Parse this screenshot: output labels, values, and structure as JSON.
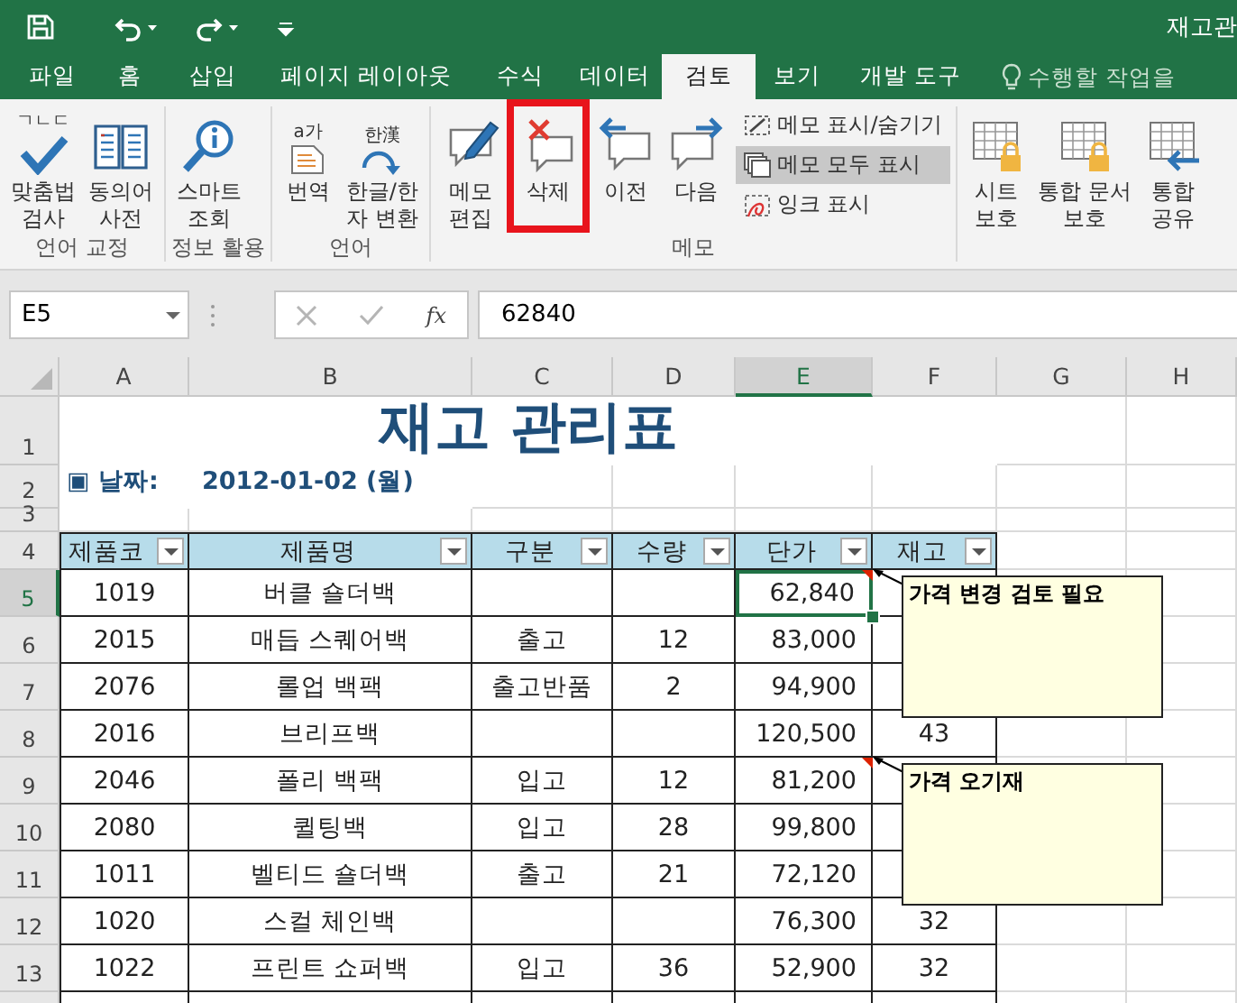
{
  "title_bar": {
    "title": "재고관"
  },
  "tabs": [
    {
      "label": "파일",
      "selected": false
    },
    {
      "label": "홈",
      "selected": false
    },
    {
      "label": "삽입",
      "selected": false
    },
    {
      "label": "페이지 레이아웃",
      "selected": false
    },
    {
      "label": "수식",
      "selected": false
    },
    {
      "label": "데이터",
      "selected": false
    },
    {
      "label": "검토",
      "selected": true
    },
    {
      "label": "보기",
      "selected": false
    },
    {
      "label": "개발 도구",
      "selected": false
    }
  ],
  "tell_me": {
    "placeholder": "수행할 작업을"
  },
  "ribbon": {
    "groups": [
      {
        "label": "언어 교정",
        "buttons": [
          {
            "kind": "large",
            "label": "맞춤법\n검사",
            "icon_text": "ㄱㄴㄷ",
            "highlighted": false
          },
          {
            "kind": "large",
            "label": "동의어\n사전",
            "highlighted": false
          }
        ]
      },
      {
        "label": "정보 활용",
        "buttons": [
          {
            "kind": "large",
            "label": "스마트\n조회",
            "highlighted": false
          }
        ]
      },
      {
        "label": "언어",
        "buttons": [
          {
            "kind": "large",
            "label": "번역",
            "icon_text": "a가",
            "highlighted": false
          },
          {
            "kind": "large",
            "label": "한글/한\n자 변환",
            "icon_text": "한漢",
            "highlighted": false
          }
        ]
      },
      {
        "label": "메모",
        "buttons": [
          {
            "kind": "large",
            "label": "메모\n편집",
            "highlighted": false
          },
          {
            "kind": "large",
            "label": "삭제",
            "highlighted": true
          },
          {
            "kind": "large",
            "label": "이전",
            "highlighted": false
          },
          {
            "kind": "large",
            "label": "다음",
            "highlighted": false
          },
          {
            "kind": "small",
            "label": "메모 표시/숨기기",
            "selected": false
          },
          {
            "kind": "small",
            "label": "메모 모두 표시",
            "selected": true
          },
          {
            "kind": "small",
            "label": "잉크 표시",
            "selected": false
          }
        ]
      },
      {
        "buttons": [
          {
            "kind": "large",
            "label": "시트\n보호",
            "highlighted": false
          },
          {
            "kind": "large",
            "label": "통합 문서\n보호",
            "highlighted": false
          },
          {
            "kind": "large",
            "label": "통합\n공유",
            "highlighted": false
          }
        ]
      }
    ]
  },
  "formula_bar": {
    "name_box": "E5",
    "function_button": "fx",
    "value": "62840"
  },
  "sheet": {
    "columns": [
      {
        "label": "A",
        "selected": false
      },
      {
        "label": "B",
        "selected": false
      },
      {
        "label": "C",
        "selected": false
      },
      {
        "label": "D",
        "selected": false
      },
      {
        "label": "E",
        "selected": true
      },
      {
        "label": "F",
        "selected": false
      },
      {
        "label": "G",
        "selected": false
      },
      {
        "label": "H",
        "selected": false
      }
    ],
    "row_headers": [
      {
        "label": "1",
        "selected": false
      },
      {
        "label": "2",
        "selected": false
      },
      {
        "label": "3",
        "selected": false
      },
      {
        "label": "4",
        "selected": false
      },
      {
        "label": "5",
        "selected": true
      },
      {
        "label": "6",
        "selected": false
      },
      {
        "label": "7",
        "selected": false
      },
      {
        "label": "8",
        "selected": false
      },
      {
        "label": "9",
        "selected": false
      },
      {
        "label": "10",
        "selected": false
      },
      {
        "label": "11",
        "selected": false
      },
      {
        "label": "12",
        "selected": false
      },
      {
        "label": "13",
        "selected": false
      }
    ],
    "title": "재고 관리표",
    "date_label": "▣ 날짜:",
    "date_value": "2012-01-02 (월)",
    "table": {
      "columns": [
        "제품코",
        "제품명",
        "구분",
        "수량",
        "단가",
        "재고"
      ],
      "rows": [
        {
          "code": "1019",
          "name": "버클 숄더백",
          "price": "62,840",
          "selected": true,
          "has_comment": true
        },
        {
          "code": "2015",
          "name": "매듭 스퀘어백",
          "type": "출고",
          "qty": "12",
          "price": "83,000",
          "selected": false,
          "has_comment": false
        },
        {
          "code": "2076",
          "name": "롤업 백팩",
          "type": "출고반품",
          "qty": "2",
          "price": "94,900",
          "selected": false,
          "has_comment": false
        },
        {
          "code": "2016",
          "name": "브리프백",
          "price": "120,500",
          "stock": "43",
          "selected": false,
          "has_comment": false
        },
        {
          "code": "2046",
          "name": "폴리 백팩",
          "type": "입고",
          "qty": "12",
          "price": "81,200",
          "selected": false,
          "has_comment": true
        },
        {
          "code": "2080",
          "name": "퀼팅백",
          "type": "입고",
          "qty": "28",
          "price": "99,800",
          "selected": false,
          "has_comment": false
        },
        {
          "code": "1011",
          "name": "벨티드 숄더백",
          "type": "출고",
          "qty": "21",
          "price": "72,120",
          "selected": false,
          "has_comment": false
        },
        {
          "code": "1020",
          "name": "스컬 체인백",
          "price": "76,300",
          "stock": "32",
          "selected": false,
          "has_comment": false
        },
        {
          "code": "1022",
          "name": "프린트 쇼퍼백",
          "type": "입고",
          "qty": "36",
          "price": "52,900",
          "stock": "32",
          "selected": false,
          "has_comment": false
        }
      ]
    },
    "comments": [
      {
        "text": "가격 변경 검토 필요"
      },
      {
        "text": "가격 오기재"
      }
    ]
  }
}
